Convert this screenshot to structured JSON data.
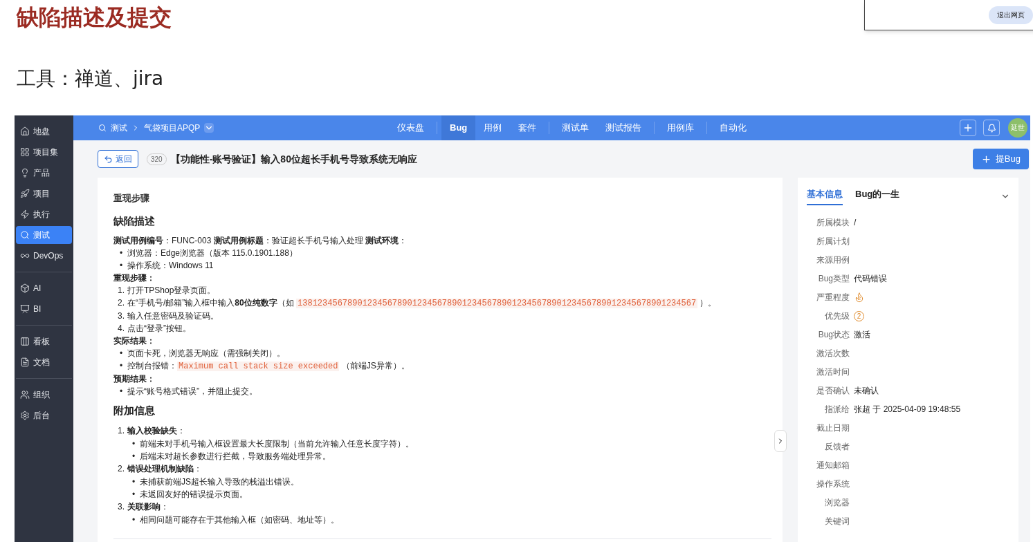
{
  "slide": {
    "title": "缺陷描述及提交",
    "subtitle": "工具：禅道、jira"
  },
  "popup": {
    "button": "退出网页"
  },
  "sidebar": {
    "groups": [
      [
        {
          "label": "地盘",
          "selected": false
        },
        {
          "label": "项目集",
          "selected": false
        },
        {
          "label": "产品",
          "selected": false
        },
        {
          "label": "项目",
          "selected": false
        },
        {
          "label": "执行",
          "selected": false
        },
        {
          "label": "测试",
          "selected": true
        },
        {
          "label": "DevOps",
          "selected": false
        }
      ],
      [
        {
          "label": "AI",
          "selected": false
        },
        {
          "label": "BI",
          "selected": false
        }
      ],
      [
        {
          "label": "看板",
          "selected": false
        },
        {
          "label": "文档",
          "selected": false
        }
      ],
      [
        {
          "label": "组织",
          "selected": false
        },
        {
          "label": "后台",
          "selected": false
        }
      ]
    ]
  },
  "topbar": {
    "breadcrumb": [
      "测试",
      "气袋项目APQP"
    ],
    "nav_groups": [
      [
        {
          "label": "仪表盘",
          "selected": false
        }
      ],
      [
        {
          "label": "Bug",
          "selected": true
        },
        {
          "label": "用例",
          "selected": false
        },
        {
          "label": "套件",
          "selected": false
        }
      ],
      [
        {
          "label": "测试单",
          "selected": false
        },
        {
          "label": "测试报告",
          "selected": false
        }
      ],
      [
        {
          "label": "用例库",
          "selected": false
        }
      ],
      [
        {
          "label": "自动化",
          "selected": false
        }
      ]
    ],
    "avatar": "延世"
  },
  "header": {
    "back": "返回",
    "id": "320",
    "title": "【功能性-账号验证】输入80位超长手机号导致系统无响应",
    "create_button": "提Bug"
  },
  "content": [
    {
      "kind": "caption",
      "parts": [
        {
          "kind": "text",
          "text": "重现步骤"
        }
      ]
    },
    {
      "kind": "heading",
      "parts": [
        {
          "kind": "text",
          "text": "缺陷描述"
        }
      ]
    },
    {
      "kind": "para",
      "parts": [
        {
          "kind": "text",
          "text": "**测试用例编号**：FUNC-003 **测试用例标题**：验证超长手机号输入处理 **测试环境**："
        }
      ]
    },
    {
      "kind": "item",
      "marker": "•",
      "parts": [
        {
          "kind": "text",
          "text": "浏览器：Edge浏览器（版本 115.0.1901.188）"
        }
      ]
    },
    {
      "kind": "item",
      "marker": "•",
      "parts": [
        {
          "kind": "text",
          "text": "操作系统：Windows 11"
        }
      ]
    },
    {
      "kind": "label",
      "parts": [
        {
          "kind": "text",
          "text": "重现步骤："
        }
      ]
    },
    {
      "kind": "item",
      "marker": "1.",
      "parts": [
        {
          "kind": "text",
          "text": "打开TPShop登录页面。"
        }
      ]
    },
    {
      "kind": "item",
      "marker": "2.",
      "parts": [
        {
          "kind": "text",
          "text": "在“手机号/邮箱”输入框中输入**80位纯数字**（如 "
        },
        {
          "kind": "code",
          "text": "13812345678901234567890123456789012345678901234567890123456789012345678901234567"
        },
        {
          "kind": "text",
          "text": " ）。"
        }
      ]
    },
    {
      "kind": "item",
      "marker": "3.",
      "parts": [
        {
          "kind": "text",
          "text": "输入任意密码及验证码。"
        }
      ]
    },
    {
      "kind": "item",
      "marker": "4.",
      "parts": [
        {
          "kind": "text",
          "text": "点击“登录”按钮。"
        }
      ]
    },
    {
      "kind": "label",
      "parts": [
        {
          "kind": "text",
          "text": "实际结果："
        }
      ]
    },
    {
      "kind": "item",
      "marker": "•",
      "parts": [
        {
          "kind": "text",
          "text": "页面卡死，浏览器无响应（需强制关闭）。"
        }
      ]
    },
    {
      "kind": "item",
      "marker": "•",
      "parts": [
        {
          "kind": "text",
          "text": "控制台报错："
        },
        {
          "kind": "code",
          "text": "Maximum call stack size exceeded"
        },
        {
          "kind": "text",
          "text": " （前端JS异常）。"
        }
      ]
    },
    {
      "kind": "label",
      "parts": [
        {
          "kind": "text",
          "text": "预期结果："
        }
      ]
    },
    {
      "kind": "item",
      "marker": "•",
      "parts": [
        {
          "kind": "text",
          "text": "提示“账号格式错误”，并阻止提交。"
        }
      ]
    },
    {
      "kind": "heading",
      "parts": [
        {
          "kind": "text",
          "text": "附加信息"
        }
      ]
    },
    {
      "kind": "item",
      "marker": "1.",
      "parts": [
        {
          "kind": "text",
          "text": "**输入校验缺失**："
        }
      ],
      "children": [
        {
          "kind": "item",
          "marker": "•",
          "parts": [
            {
              "kind": "text",
              "text": "前端未对手机号输入框设置最大长度限制（当前允许输入任意长度字符）。"
            }
          ]
        },
        {
          "kind": "item",
          "marker": "•",
          "parts": [
            {
              "kind": "text",
              "text": "后端未对超长参数进行拦截，导致服务端处理异常。"
            }
          ]
        }
      ]
    },
    {
      "kind": "item",
      "marker": "2.",
      "parts": [
        {
          "kind": "text",
          "text": "**错误处理机制缺陷**："
        }
      ],
      "children": [
        {
          "kind": "item",
          "marker": "•",
          "parts": [
            {
              "kind": "text",
              "text": "未捕获前端JS超长输入导致的栈溢出错误。"
            }
          ]
        },
        {
          "kind": "item",
          "marker": "•",
          "parts": [
            {
              "kind": "text",
              "text": "未返回友好的错误提示页面。"
            }
          ]
        }
      ]
    },
    {
      "kind": "item",
      "marker": "3.",
      "parts": [
        {
          "kind": "text",
          "text": "**关联影响**："
        }
      ],
      "children": [
        {
          "kind": "item",
          "marker": "•",
          "parts": [
            {
              "kind": "text",
              "text": "相同问题可能存在于其他输入框（如密码、地址等）。"
            }
          ]
        }
      ]
    }
  ],
  "info_panel": {
    "tabs": [
      {
        "label": "基本信息",
        "selected": true
      },
      {
        "label": "Bug的一生",
        "selected": false
      }
    ],
    "fields": [
      {
        "label": "所属模块",
        "kind": "text",
        "value": "/"
      },
      {
        "label": "所属计划",
        "kind": "text"
      },
      {
        "label": "来源用例",
        "kind": "text"
      },
      {
        "label": "Bug类型",
        "kind": "text",
        "value": "代码错误"
      },
      {
        "label": "严重程度",
        "kind": "severity",
        "value": "2"
      },
      {
        "label": "优先级",
        "kind": "priority",
        "value": "2"
      },
      {
        "label": "Bug状态",
        "kind": "text",
        "value": "激活"
      },
      {
        "label": "激活次数",
        "kind": "text"
      },
      {
        "label": "激活时间",
        "kind": "text"
      },
      {
        "label": "是否确认",
        "kind": "text",
        "value": "未确认"
      },
      {
        "label": "指派给",
        "kind": "text",
        "value": "张超 于 2025-04-09 19:48:55"
      },
      {
        "label": "截止日期",
        "kind": "text"
      },
      {
        "label": "反馈者",
        "kind": "text"
      },
      {
        "label": "通知邮箱",
        "kind": "text"
      },
      {
        "label": "操作系统",
        "kind": "text"
      },
      {
        "label": "浏览器",
        "kind": "text"
      },
      {
        "label": "关键词",
        "kind": "text"
      }
    ]
  }
}
